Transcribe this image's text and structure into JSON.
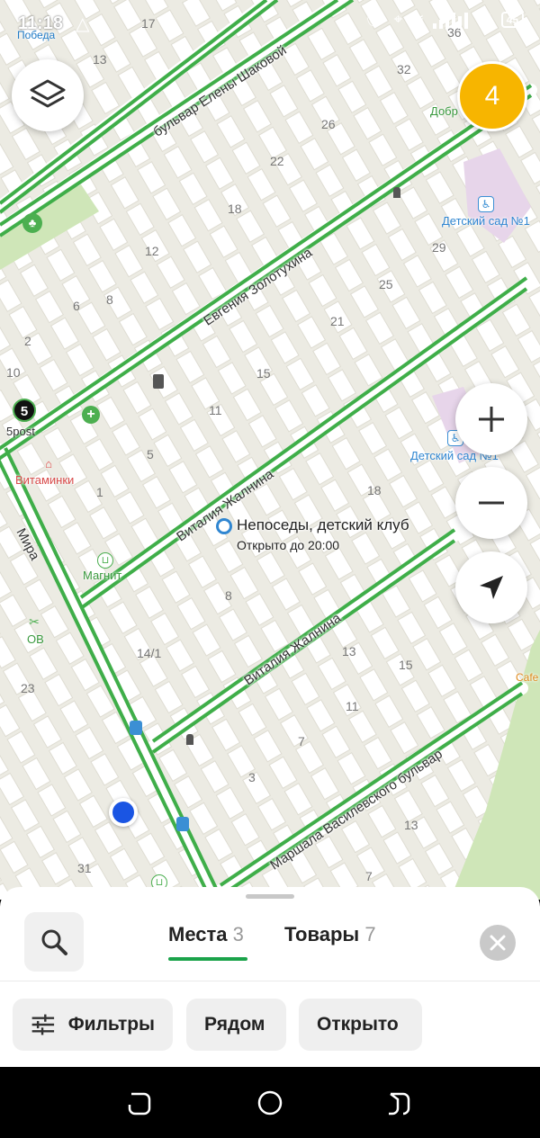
{
  "status_bar": {
    "time": "11:18",
    "battery": "45"
  },
  "map": {
    "streets": [
      {
        "name": "бульвар Елены Шаковой"
      },
      {
        "name": "Евгения Золотухина"
      },
      {
        "name": "Виталия Жалнина"
      },
      {
        "name": "Виталия Жалнина"
      },
      {
        "name": "Маршала Василевского бульвар"
      },
      {
        "name": "Мира"
      }
    ],
    "house_numbers": [
      "17",
      "13",
      "36",
      "32",
      "26",
      "22",
      "18",
      "12",
      "8",
      "6",
      "2",
      "10",
      "29",
      "25",
      "21",
      "15",
      "11",
      "5",
      "1",
      "18",
      "8",
      "14/1",
      "13",
      "15",
      "11",
      "7",
      "3",
      "23",
      "13",
      "7",
      "31"
    ],
    "pois": {
      "pobeda": "Победа",
      "dobr": "Добр",
      "kindergarten1": "Детский сад №1",
      "kindergarten2": "Детский сад №1",
      "fivepost": "5post",
      "fivepost_badge": "5",
      "vitaminki": "Витаминки",
      "magnit": "Магнит",
      "ov": "ОВ",
      "cafe": "Cafe"
    },
    "selected_place": {
      "name": "Непоседы, детский клуб",
      "status": "Открыто до 20:00"
    },
    "results_badge": "4"
  },
  "sheet": {
    "tabs": [
      {
        "label": "Места",
        "count": "3"
      },
      {
        "label": "Товары",
        "count": "7"
      }
    ],
    "filters": [
      {
        "label": "Фильтры"
      },
      {
        "label": "Рядом"
      },
      {
        "label": "Открыто"
      }
    ]
  },
  "colors": {
    "road": "#3fae49",
    "badge": "#f7b500",
    "accent": "#1aa34a",
    "map_bg": "#f1efe6"
  }
}
